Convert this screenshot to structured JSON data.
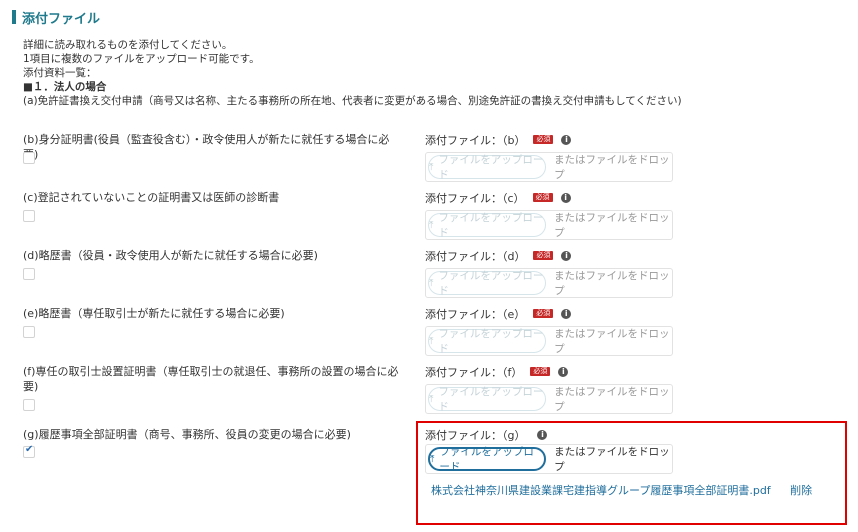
{
  "section": {
    "title": "添付ファイル"
  },
  "intro": {
    "line1": "詳細に読み取れるものを添付してください。",
    "line2": "1項目に複数のファイルをアップロード可能です。",
    "line3": "添付資料一覧：",
    "heading": "■１．法人の場合",
    "item_a": "(a)免許証書換え交付申請（商号又は名称、主たる事務所の所在地、代表者に変更がある場合、別途免許証の書換え交付申請もしてください)"
  },
  "items": [
    {
      "label": "(b)身分証明書(役員（監査役含む）・政令使用人が新たに就任する場合に必要)",
      "upload_label": "添付ファイル：（b）",
      "required": "必須",
      "checked": false
    },
    {
      "label": "(c)登記されていないことの証明書又は医師の診断書",
      "upload_label": "添付ファイル：（c）",
      "required": "必須",
      "checked": false
    },
    {
      "label": "(d)略歴書（役員・政令使用人が新たに就任する場合に必要)",
      "upload_label": "添付ファイル：（d）",
      "required": "必須",
      "checked": false
    },
    {
      "label": "(e)略歴書（専任取引士が新たに就任する場合に必要)",
      "upload_label": "添付ファイル：（e）",
      "required": "必須",
      "checked": false
    },
    {
      "label": "(f)専任の取引士設置証明書（専任取引士の就退任、事務所の設置の場合に必要)",
      "upload_label": "添付ファイル：（f）",
      "required": "必須",
      "checked": false
    },
    {
      "label": "(g)履歴事項全部証明書（商号、事務所、役員の変更の場合に必要)",
      "upload_label": "添付ファイル：（g）",
      "required": "",
      "checked": true
    }
  ],
  "upload": {
    "button_label": "ファイルをアップロード",
    "drop_text": "またはファイルをドロップ",
    "info": "i"
  },
  "attached_file": {
    "name": "株式会社神奈川県建設業課宅建指導グループ履歴事項全部証明書.pdf",
    "delete_label": "削除"
  },
  "colors": {
    "accent": "#1f7a8c",
    "link": "#1f6e9c",
    "required": "#c62828",
    "highlight": "#e00000"
  }
}
